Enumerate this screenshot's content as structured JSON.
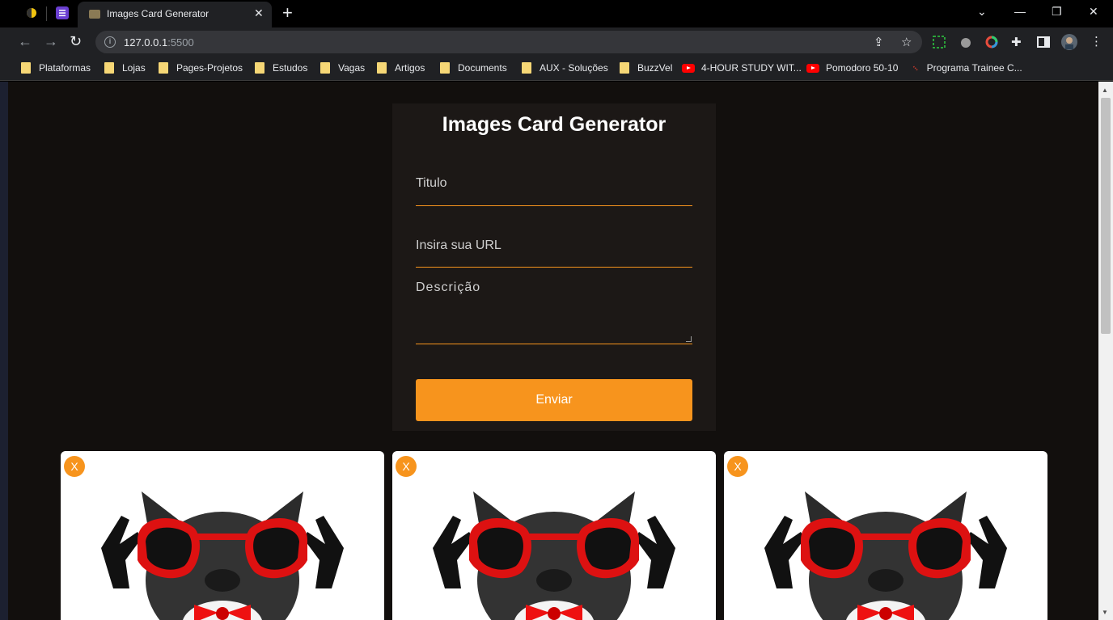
{
  "browser": {
    "tab_title": "Images Card Generator",
    "tab_close": "✕",
    "new_tab": "+",
    "url_host": "127.0.0.1",
    "url_port": ":5500",
    "window_controls": {
      "minimize": "—",
      "restore": "❐",
      "close": "✕",
      "tab_search": "⌄"
    }
  },
  "bookmarks": [
    {
      "label": "Plataformas",
      "icon": "folder-icon"
    },
    {
      "label": "Lojas",
      "icon": "folder-icon"
    },
    {
      "label": "Pages-Projetos",
      "icon": "folder-icon"
    },
    {
      "label": "Estudos",
      "icon": "folder-icon"
    },
    {
      "label": "Vagas",
      "icon": "folder-icon"
    },
    {
      "label": "Artigos",
      "icon": "folder-icon"
    },
    {
      "label": "Documents",
      "icon": "folder-icon"
    },
    {
      "label": "AUX - Soluções",
      "icon": "folder-icon"
    },
    {
      "label": "BuzzVel",
      "icon": "folder-icon"
    },
    {
      "label": "4-HOUR STUDY WIT...",
      "icon": "youtube-icon"
    },
    {
      "label": "Pomodoro 50-10",
      "icon": "youtube-icon"
    },
    {
      "label": "Programa Trainee C...",
      "icon": "brand-icon"
    }
  ],
  "form": {
    "title": "Images Card Generator",
    "title_placeholder": "Titulo",
    "url_placeholder": "Insira sua URL",
    "description_placeholder": "Descrição",
    "submit_label": "Enviar"
  },
  "cards": [
    {
      "close_label": "X"
    },
    {
      "close_label": "X"
    },
    {
      "close_label": "X"
    }
  ],
  "colors": {
    "accent": "#f7941d",
    "page_bg": "#120f0d",
    "form_bg": "#1c1816",
    "card_bg": "#ffffff"
  }
}
